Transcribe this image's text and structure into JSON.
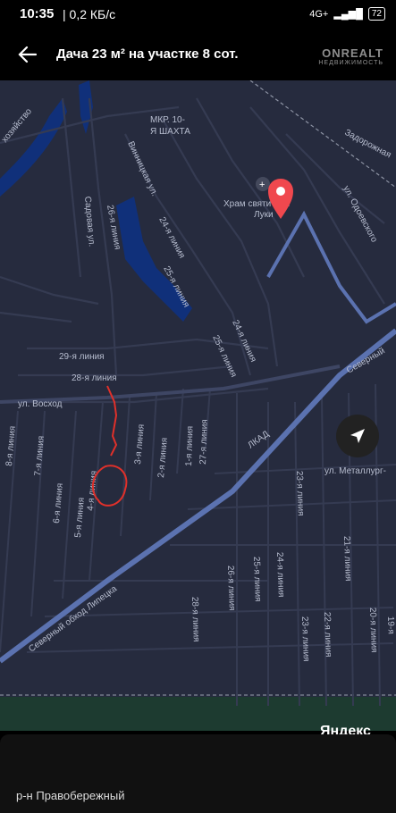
{
  "status_bar": {
    "time": "10:35",
    "info": "| 0,2 КБ/с",
    "network": "4G+",
    "battery": "72"
  },
  "header": {
    "title": "Дача 23 м² на участке 8 сот.",
    "watermark_main": "ONREALT",
    "watermark_sub": "НЕДВИЖИМОСТЬ"
  },
  "map": {
    "labels": {
      "mkr": "МКР. 10-",
      "shakhta": "Я ШАХТА",
      "vinnitskaya": "Винницкая ул.",
      "sadovaya": "Садовая ул.",
      "line26a": "26-я линия",
      "line24a": "24-я линия",
      "line25a": "25-я линия",
      "line24b": "24-я линия",
      "line25b": "25-я линия",
      "line29": "29-я линия",
      "line28": "28-я линия",
      "voskhod": "ул. Восход",
      "line8": "8-я линия",
      "line7": "7-я линия",
      "line6": "6-я линия",
      "line5": "5-я линия",
      "line4": "4-я линия",
      "line3": "3-я линия",
      "line2": "2-я линия",
      "line1": "1-я линия",
      "line27": "27-я линия",
      "lkad": "ЛКАД",
      "severny": "Северный",
      "severny_obkhod": "Северный обход Липецка",
      "metallurg": "ул. Металлург-",
      "line23a": "23-я линия",
      "line21": "21-я линия",
      "line26b": "26-я линия",
      "line25c": "25-я линия",
      "line24c": "24-я линия",
      "line28b": "28-я линия",
      "line23b": "23-я линия",
      "line22": "22-я линия",
      "line20": "20-я линия",
      "line19": "19-я",
      "zadorozhnaya": "Задорожная",
      "odoevskogo": "ул. Одоевского",
      "khram": "Храм святителя",
      "luki": "Луки",
      "khozyaystvo": "хозяйство"
    },
    "attribution": "Яндекс"
  },
  "card": {
    "district": "р-н Правобережный"
  },
  "colors": {
    "map_bg": "#262b3e",
    "road": "#3a4057",
    "major_road": "#5b72b0",
    "water": "#10307a",
    "pin": "#f0484e",
    "annotation": "#e0302a"
  }
}
